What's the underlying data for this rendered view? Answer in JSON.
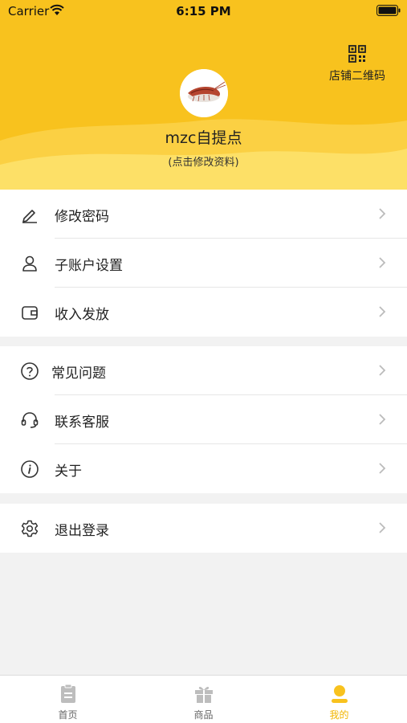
{
  "status_bar": {
    "carrier": "Carrier",
    "time": "6:15 PM"
  },
  "header": {
    "qr_label": "店铺二维码",
    "store_name": "mzc自提点",
    "edit_profile": "(点击修改资料)"
  },
  "menu": {
    "group1": [
      {
        "label": "修改密码",
        "icon": "edit-icon"
      },
      {
        "label": "子账户设置",
        "icon": "user-icon"
      },
      {
        "label": "收入发放",
        "icon": "wallet-icon"
      }
    ],
    "group2": [
      {
        "label": "常见问题",
        "icon": "help-icon"
      },
      {
        "label": "联系客服",
        "icon": "headset-icon"
      },
      {
        "label": "关于",
        "icon": "info-icon"
      }
    ],
    "group3": [
      {
        "label": "退出登录",
        "icon": "gear-icon"
      }
    ]
  },
  "tabbar": {
    "tabs": [
      {
        "label": "首页",
        "icon": "home-icon",
        "active": false
      },
      {
        "label": "商品",
        "icon": "gift-icon",
        "active": false
      },
      {
        "label": "我的",
        "icon": "profile-icon",
        "active": true
      }
    ]
  },
  "colors": {
    "accent": "#f8c21e",
    "active_tab": "#f2b600"
  }
}
